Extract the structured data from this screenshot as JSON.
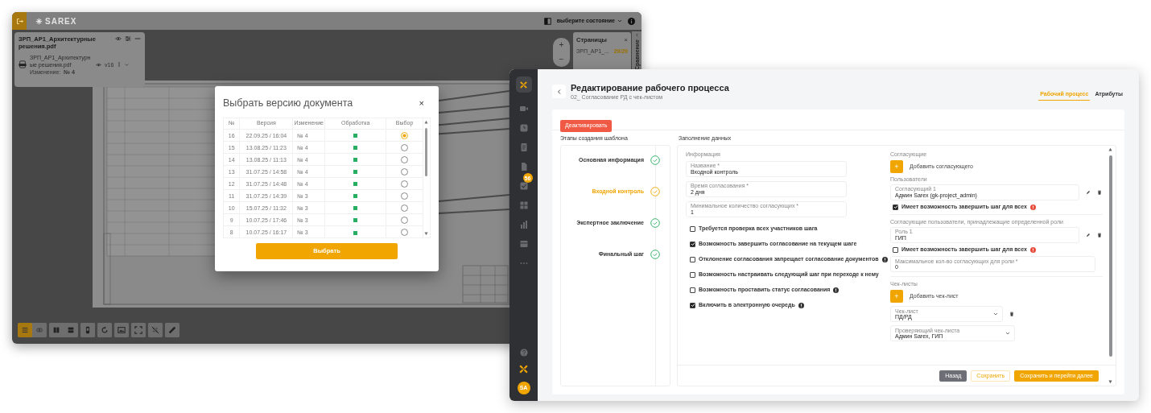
{
  "viewer": {
    "logo": "SAREX",
    "state_select": "выберите состояние",
    "document": {
      "title": "ЗРП_АР1_Архитектурные решения.pdf",
      "file_name": "ЗРП_АР1_Архитектурные решения.pdf",
      "version": "v16",
      "change_label": "Изменение:",
      "change_value": "№ 4"
    },
    "zoom_buttons": [
      "+",
      "−"
    ],
    "pages_panel": {
      "title": "Страницы",
      "close": "×",
      "file": "ЗРП_АР1_...",
      "count": "29/29"
    },
    "side_tab": "Сравнение",
    "toolbar": [
      {
        "kind": "layers",
        "selected": true
      },
      {
        "kind": "link",
        "selected": false
      },
      {
        "kind": "columns",
        "selected": false
      },
      {
        "kind": "rows",
        "selected": false
      },
      {
        "kind": "page",
        "selected": false
      },
      {
        "kind": "rotate",
        "selected": false
      },
      {
        "kind": "image",
        "selected": false
      },
      {
        "kind": "fullscreen",
        "selected": false
      },
      {
        "kind": "grid-off",
        "selected": false
      },
      {
        "kind": "ruler",
        "selected": false
      }
    ]
  },
  "version_dialog": {
    "title": "Выбрать версию документа",
    "close": "×",
    "columns": [
      "№",
      "Версия",
      "Изменение",
      "Обработка",
      "Выбор"
    ],
    "rows": [
      {
        "number": "16",
        "version": "22.09.25 / 16:04",
        "change": "№ 4",
        "processed": true,
        "selected": true
      },
      {
        "number": "15",
        "version": "13.08.25 / 11:23",
        "change": "№ 4",
        "processed": true,
        "selected": false
      },
      {
        "number": "14",
        "version": "13.08.25 / 11:13",
        "change": "№ 4",
        "processed": true,
        "selected": false
      },
      {
        "number": "13",
        "version": "31.07.25 / 14:58",
        "change": "№ 4",
        "processed": true,
        "selected": false
      },
      {
        "number": "12",
        "version": "31.07.25 / 14:48",
        "change": "№ 4",
        "processed": true,
        "selected": false
      },
      {
        "number": "11",
        "version": "31.07.25 / 14:39",
        "change": "№ 3",
        "processed": true,
        "selected": false
      },
      {
        "number": "10",
        "version": "15.07.25 / 11:32",
        "change": "№ 3",
        "processed": true,
        "selected": false
      },
      {
        "number": "9",
        "version": "10.07.25 / 17:46",
        "change": "№ 3",
        "processed": true,
        "selected": false
      },
      {
        "number": "8",
        "version": "10.07.25 / 16:17",
        "change": "№ 3",
        "processed": true,
        "selected": false
      }
    ],
    "button": "Выбрать"
  },
  "workflow_editor": {
    "sidebar": {
      "items": [
        {
          "kind": "video"
        },
        {
          "kind": "clock"
        },
        {
          "kind": "document"
        },
        {
          "kind": "file"
        },
        {
          "kind": "checklist",
          "badge": "56"
        },
        {
          "kind": "grid"
        },
        {
          "kind": "chart"
        },
        {
          "kind": "layers"
        },
        {
          "kind": "more"
        }
      ],
      "avatar": "SA"
    },
    "title": "Редактирование рабочего процесса",
    "subtitle": "02_ Согласование РД с чек-листом",
    "tabs": [
      {
        "label": "Рабочий процесс",
        "selected": true
      },
      {
        "label": "Атрибуты",
        "selected": false
      }
    ],
    "deactivate_button": "Деактивировать",
    "steps_heading": "Этапы создания шаблона",
    "form_heading": "Заполнение данных",
    "steps": [
      {
        "label": "Основная информация",
        "selected": false
      },
      {
        "label": "Входной контроль",
        "selected": true
      },
      {
        "label": "Экспертное заключение",
        "selected": false
      },
      {
        "label": "Финальный шаг",
        "selected": false
      }
    ],
    "info_heading": "Информация",
    "info_fields": [
      {
        "label": "Название *",
        "value": "Входной контроль"
      },
      {
        "label": "Время согласования *",
        "value": "2 дня"
      },
      {
        "label": "Минимальное количество согласующих *",
        "value": "1"
      }
    ],
    "options": [
      {
        "label": "Требуется проверка всех участников шага",
        "checked": false,
        "help": false
      },
      {
        "label": "Возможность завершить согласование на текущем шаге",
        "checked": true,
        "help": false
      },
      {
        "label": "Отклонение согласования запрещает согласование документов",
        "checked": false,
        "help": true
      },
      {
        "label": "Возможность настраивать следующий шаг при переходе к нему",
        "checked": false,
        "help": false
      },
      {
        "label": "Возможность проставить статус согласования",
        "checked": false,
        "help": true
      },
      {
        "label": "Включить в электронную очередь",
        "checked": true,
        "help": true
      }
    ],
    "approvers": {
      "heading": "Согласующие",
      "add_button": "+",
      "add_label": "Добавить согласующего",
      "users_heading": "Пользователи",
      "users": [
        {
          "label": "Согласующий 1",
          "value": "Админ Sarex (gk-project_admin)",
          "option": "Имеет возможность завершить шаг для всех",
          "checked": true
        }
      ],
      "roles_heading": "Согласующие пользователи, принадлежащие определенной роли",
      "roles": [
        {
          "label": "Роль 1",
          "value": "ГИП",
          "option": "Имеет возможность завершить шаг для всех",
          "checked": false
        }
      ],
      "role_limit": {
        "label": "Максимальное кол-во согласующих для роли *",
        "value": "0"
      }
    },
    "checklists": {
      "heading": "Чек-листы",
      "add_button": "+",
      "add_label": "Добавить чек-лист",
      "selects": [
        {
          "label": "Чек-лист",
          "value": "ПД/РД",
          "deletable": true
        },
        {
          "label": "Проверяющий чек-листа",
          "value": "Админ Sarex, ГИП",
          "deletable": false
        }
      ]
    },
    "buttons": [
      {
        "kind": "back",
        "label": "Назад"
      },
      {
        "kind": "save",
        "label": "Сохранить"
      },
      {
        "kind": "save-next",
        "label": "Сохранить и перейти далее"
      }
    ]
  }
}
